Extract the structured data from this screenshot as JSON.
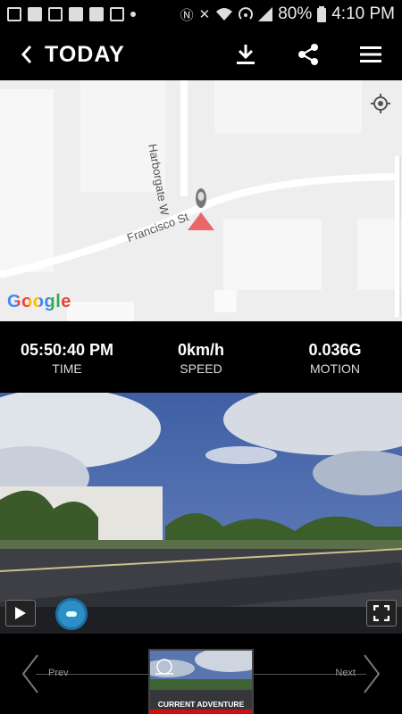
{
  "status_bar": {
    "battery": "80%",
    "time": "4:10 PM"
  },
  "header": {
    "title": "TODAY",
    "back_icon": "back-arrow-icon",
    "download_icon": "download-icon",
    "share_icon": "share-icon",
    "menu_icon": "hamburger-menu-icon"
  },
  "map": {
    "streets": [
      "Harborgate W",
      "Francisco St"
    ],
    "attribution": "Google",
    "attribution_colors": [
      "#4285F4",
      "#EA4335",
      "#FBBC05",
      "#4285F4",
      "#34A853",
      "#EA4335"
    ]
  },
  "stats": [
    {
      "value": "05:50:40 PM",
      "label": "TIME"
    },
    {
      "value": "0km/h",
      "label": "SPEED"
    },
    {
      "value": "0.036G",
      "label": "MOTION"
    }
  ],
  "player": {
    "play_icon": "play-icon",
    "fullscreen_icon": "fullscreen-icon",
    "progress": 0.0
  },
  "navigation": {
    "prev_label": "Prev",
    "next_label": "Next",
    "current_label": "CURRENT ADVENTURE",
    "accent_color": "#d01010"
  }
}
